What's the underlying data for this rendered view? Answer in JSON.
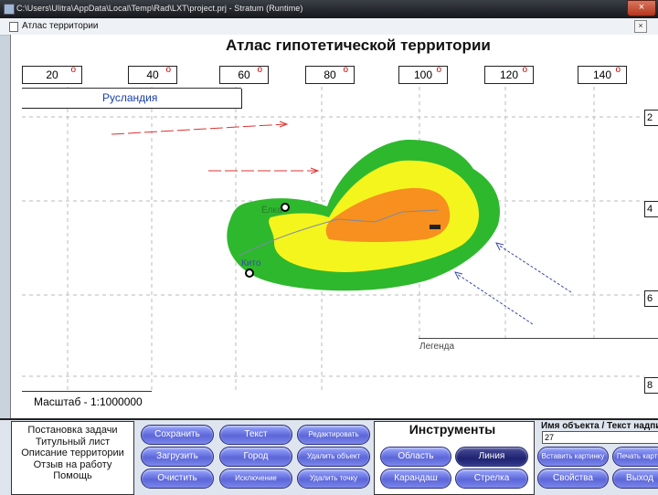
{
  "window": {
    "title": "C:\\Users\\Ulitra\\AppData\\Local\\Temp\\Rad\\LXT\\project.prj - Stratum (Runtime)",
    "close": "×"
  },
  "form": {
    "title": "Атлас территории",
    "close": "×"
  },
  "map": {
    "title": "Атлас гипотетической территории",
    "degrees": [
      {
        "value": "20",
        "mark": "о"
      },
      {
        "value": "40",
        "mark": "о"
      },
      {
        "value": "60",
        "mark": "о"
      },
      {
        "value": "80",
        "mark": "о"
      },
      {
        "value": "100",
        "mark": "о"
      },
      {
        "value": "120",
        "mark": "о"
      },
      {
        "value": "140",
        "mark": "о"
      }
    ],
    "side_coords": [
      "2",
      "4",
      "6",
      "8"
    ],
    "region_label": "Русландия",
    "city_labels": [
      "Ёлка",
      "Кито"
    ],
    "legend_label": "Легенда",
    "scale_label": "Масштаб - 1:1000000",
    "colors": {
      "green": "#2eb82e",
      "yellow": "#f5f51e",
      "orange": "#f7901e",
      "arrow_red": "#d33",
      "arrow_blue": "#3a4aa8"
    }
  },
  "menu": {
    "items": [
      "Постановка задачи",
      "Титульный лист",
      "Описание территории",
      "Отзыв на работу",
      "Помощь"
    ]
  },
  "buttons": {
    "save": "Сохранить",
    "load": "Загрузить",
    "clear": "Очистить",
    "text": "Текст",
    "city": "Город",
    "exception": "Исключение",
    "edit": "Редактировать",
    "delete_object": "Удалить объект",
    "delete_point": "Удалить точку",
    "area": "Область",
    "line": "Линия",
    "pencil": "Карандаш",
    "arrow": "Стрелка",
    "export": "Вставить картинку",
    "print": "Печать карты",
    "properties": "Свойства",
    "exit": "Выход"
  },
  "tools": {
    "title": "Инструменты"
  },
  "object": {
    "label": "Имя объекта / Текст надписи",
    "value": "27"
  }
}
